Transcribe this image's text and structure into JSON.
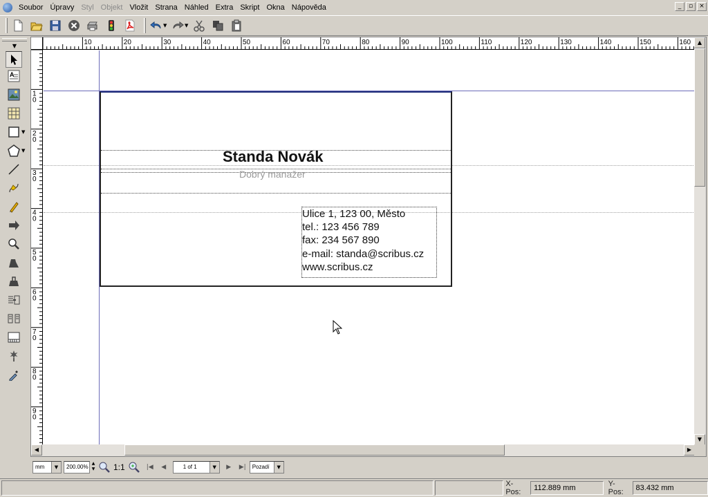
{
  "menu": {
    "items": [
      {
        "label": "Soubor",
        "enabled": true
      },
      {
        "label": "Úpravy",
        "enabled": true
      },
      {
        "label": "Styl",
        "enabled": false
      },
      {
        "label": "Objekt",
        "enabled": false
      },
      {
        "label": "Vložit",
        "enabled": true
      },
      {
        "label": "Strana",
        "enabled": true
      },
      {
        "label": "Náhled",
        "enabled": true
      },
      {
        "label": "Extra",
        "enabled": true
      },
      {
        "label": "Skript",
        "enabled": true
      },
      {
        "label": "Okna",
        "enabled": true
      },
      {
        "label": "Nápověda",
        "enabled": true
      }
    ]
  },
  "toolbar": {
    "buttons": [
      "new-icon",
      "open-icon",
      "save-icon",
      "close-icon",
      "print-icon",
      "preflight-icon",
      "pdf-icon",
      "undo-icon",
      "redo-icon",
      "cut-icon",
      "copy-icon",
      "paste-icon"
    ]
  },
  "tools": [
    "select-icon",
    "text-frame-icon",
    "image-frame-icon",
    "table-icon",
    "shape-icon",
    "polygon-icon",
    "line-icon",
    "bezier-icon",
    "freehand-icon",
    "rotate-icon",
    "zoom-icon",
    "edit-contents-icon",
    "edit-text-icon",
    "link-frames-icon",
    "unlink-frames-icon",
    "measure-icon",
    "copy-properties-icon",
    "eyedropper-icon"
  ],
  "rulers": {
    "horizontal": [
      "10",
      "20",
      "30",
      "40",
      "50",
      "60",
      "70",
      "80",
      "90",
      "100",
      "110",
      "120",
      "130",
      "140",
      "150",
      "160"
    ],
    "vertical": [
      [
        "1",
        "0"
      ],
      [
        "2",
        "0"
      ],
      [
        "3",
        "0"
      ],
      [
        "4",
        "0"
      ],
      [
        "5",
        "0"
      ],
      [
        "6",
        "0"
      ],
      [
        "7",
        "0"
      ],
      [
        "8",
        "0"
      ],
      [
        "9",
        "0"
      ],
      [
        "1",
        "0",
        "0"
      ]
    ]
  },
  "card": {
    "name": "Standa Novák",
    "title": "Dobrý manažer",
    "contact": [
      "Ulice 1, 123 00, Město",
      "tel.: 123 456 789",
      "fax: 234 567 890",
      "e-mail: standa@scribus.cz",
      "www.scribus.cz"
    ]
  },
  "navbar": {
    "unit": "mm",
    "zoom": "200.00%",
    "zoom_one": "1:1",
    "page": "1 of 1",
    "layer": "Pozadí"
  },
  "status": {
    "xpos_label": "X-Pos:",
    "xpos_value": "112.889 mm",
    "ypos_label": "Y-Pos:",
    "ypos_value": "83.432 mm"
  }
}
